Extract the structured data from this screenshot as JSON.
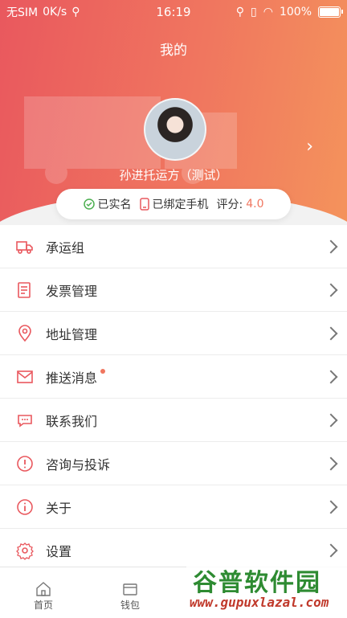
{
  "status_bar": {
    "carrier": "无SIM",
    "speed": "0K/s",
    "time": "16:19",
    "battery": "100%"
  },
  "header": {
    "title": "我的",
    "username": "孙进托运方（测试）"
  },
  "badges": {
    "verified": "已实名",
    "phone": "已绑定手机",
    "score_label": "评分:",
    "score_value": "4.0"
  },
  "menu": [
    {
      "label": "承运组",
      "icon": "truck-icon"
    },
    {
      "label": "发票管理",
      "icon": "invoice-icon"
    },
    {
      "label": "地址管理",
      "icon": "location-icon"
    },
    {
      "label": "推送消息",
      "icon": "mail-icon",
      "dot": true
    },
    {
      "label": "联系我们",
      "icon": "chat-icon"
    },
    {
      "label": "咨询与投诉",
      "icon": "alert-icon"
    },
    {
      "label": "关于",
      "icon": "info-icon"
    },
    {
      "label": "设置",
      "icon": "gear-icon"
    }
  ],
  "nav": [
    {
      "label": "首页",
      "icon": "home-icon"
    },
    {
      "label": "钱包",
      "icon": "wallet-icon"
    }
  ],
  "watermark": {
    "title": "谷普软件园",
    "url": "www.gupuxlazal.com"
  },
  "colors": {
    "accent": "#f0765f",
    "gradient_start": "#e9585e",
    "gradient_end": "#f4935c"
  }
}
